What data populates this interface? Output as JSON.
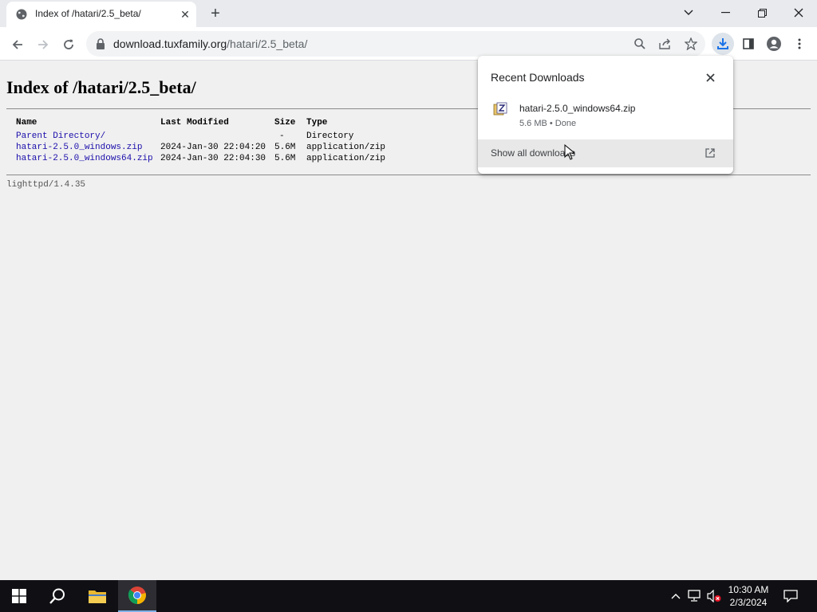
{
  "browser": {
    "tab": {
      "title": "Index of /hatari/2.5_beta/"
    },
    "url": {
      "host": "download.tuxfamily.org",
      "path": "/hatari/2.5_beta/"
    }
  },
  "page": {
    "heading": "Index of /hatari/2.5_beta/",
    "columns": {
      "name": "Name",
      "modified": "Last Modified",
      "size": "Size",
      "type": "Type"
    },
    "rows": [
      {
        "name": "Parent Directory/",
        "modified": "",
        "size": "-",
        "type": "Directory"
      },
      {
        "name": "hatari-2.5.0_windows.zip",
        "modified": "2024-Jan-30 22:04:20",
        "size": "5.6M",
        "type": "application/zip"
      },
      {
        "name": "hatari-2.5.0_windows64.zip",
        "modified": "2024-Jan-30 22:04:30",
        "size": "5.6M",
        "type": "application/zip"
      }
    ],
    "footer": "lighttpd/1.4.35"
  },
  "downloads_bubble": {
    "title": "Recent Downloads",
    "item": {
      "filename": "hatari-2.5.0_windows64.zip",
      "meta": "5.6 MB • Done"
    },
    "show_all": "Show all downloads"
  },
  "taskbar": {
    "time": "10:30 AM",
    "date": "2/3/2024"
  },
  "colors": {
    "link": "#1a0dab",
    "accent": "#1a73e8"
  }
}
